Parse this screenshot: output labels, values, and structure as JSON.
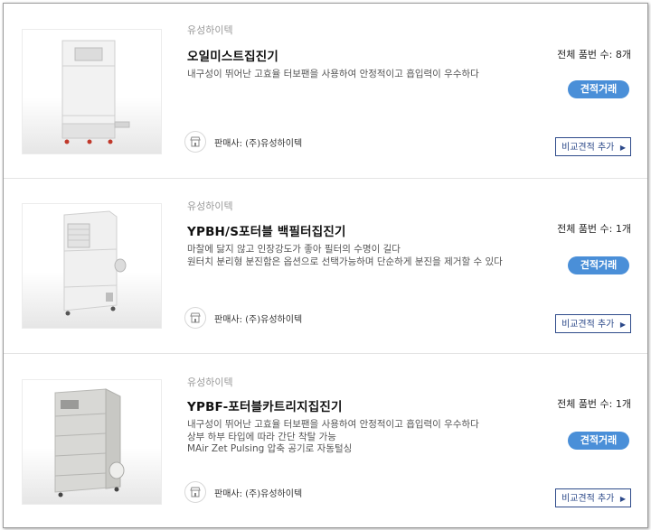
{
  "products": [
    {
      "brand": "유성하이텍",
      "title": "오일미스트집진기",
      "description": [
        "내구성이 뛰어난 고효율 터보팬을 사용하여 안정적이고 흡입력이 우수하다"
      ],
      "seller": "판매사: (주)유성하이텍",
      "count": "전체 품번 수: 8개",
      "quote_label": "견적거래",
      "compare_label": "비교견적 추가",
      "image": "oil-mist-collector-image"
    },
    {
      "brand": "유성하이텍",
      "title": "YPBH/S포터블 백필터집진기",
      "description": [
        "마찰에 닳지 않고 인장강도가 좋아 필터의 수명이 길다",
        "원터치 분리형 분진함은 옵션으로 선택가능하며 단순하게 분진을 제거할 수 있다"
      ],
      "seller": "판매사: (주)유성하이텍",
      "count": "전체 품번 수: 1개",
      "quote_label": "견적거래",
      "compare_label": "비교견적 추가",
      "image": "bag-filter-collector-image"
    },
    {
      "brand": "유성하이텍",
      "title": "YPBF-포터블카트리지집진기",
      "description": [
        "내구성이 뛰어난 고효율 터보팬을 사용하여 안정적이고 흡입력이 우수하다",
        "상부 하부 타입에 따라 간단 착탈 가능",
        "MAir Zet Pulsing 압축 공기로 자동털싱"
      ],
      "seller": "판매사: (주)유성하이텍",
      "count": "전체 품번 수: 1개",
      "quote_label": "견적거래",
      "compare_label": "비교견적 추가",
      "image": "cartridge-collector-image"
    }
  ],
  "icons": {
    "store": "store-icon",
    "arrow": "chevron-right-icon"
  },
  "colors": {
    "quote_button": "#4a8fd8",
    "compare_border": "#2d4a8a",
    "brand_text": "#9a9a9a"
  }
}
